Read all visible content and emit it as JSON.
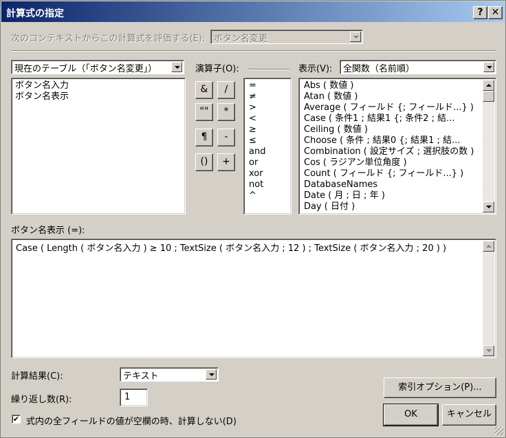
{
  "window": {
    "title": "計算式の指定",
    "help_btn": "?",
    "close_btn": "✕"
  },
  "context": {
    "label": "次のコンテキストからこの計算式を評価する(E):",
    "value": "ボタン名変更"
  },
  "fields": {
    "table_value": "現在のテーブル（「ボタン名変更」）",
    "items": [
      "ボタン名入力",
      "ボタン名表示"
    ]
  },
  "operators": {
    "label": "演算子(O):",
    "buttons": [
      "&",
      "/",
      "\"\"",
      "*",
      "¶",
      "-",
      "()",
      "+"
    ],
    "list": [
      "=",
      "≠",
      ">",
      "<",
      "≥",
      "≤",
      "and",
      "or",
      "xor",
      "not",
      "^"
    ]
  },
  "functions": {
    "label": "表示(V):",
    "view_value": "全関数（名前順）",
    "items": [
      "Abs ( 数値 )",
      "Atan ( 数値 )",
      "Average ( フィールド {; フィールド...} )",
      "Case ( 条件1 ; 結果1 {; 条件2 ; 結...",
      "Ceiling ( 数値 )",
      "Choose ( 条件 ; 結果0 {; 結果1 ; 結...",
      "Combination ( 設定サイズ ; 選択肢の数 )",
      "Cos ( ラジアン単位角度 )",
      "Count ( フィールド {; フィールド...} )",
      "DatabaseNames",
      "Date ( 月 ; 日 ; 年 )",
      "Day ( 日付 )"
    ]
  },
  "formula": {
    "label": "ボタン名表示 (=):",
    "text": "Case ( Length ( ボタン名入力 ) ≥ 10 ; TextSize ( ボタン名入力 ; 12 ) ; TextSize ( ボタン名入力 ; 20 ) )"
  },
  "result": {
    "label": "計算結果(C):",
    "value": "テキスト"
  },
  "repeat": {
    "label": "繰り返し数(R):",
    "value": "1"
  },
  "checkbox": {
    "label": "式内の全フィールドの値が空欄の時、計算しない(D)",
    "checked": true,
    "mark": "✔"
  },
  "buttons": {
    "index_options": "索引オプション(P)...",
    "ok": "OK",
    "cancel": "キャンセル"
  }
}
